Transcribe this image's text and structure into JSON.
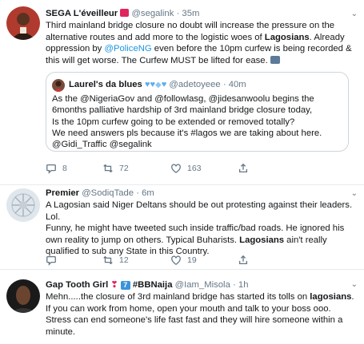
{
  "tweets": [
    {
      "name": "SEGA L'éveilleur",
      "handle": "@segalink",
      "time": "35m",
      "body": [
        "Third mainland bridge closure no doubt will increase the pressure on the",
        "alternative routes and add more to the logistic woes of ",
        "Lagosians",
        ". Already",
        "oppression by ",
        "@PoliceNG",
        " even before the 10pm curfew is being recorded &",
        "this will get worse. The Curfew MUST be lifted for ease."
      ],
      "quote": {
        "name": "Laurel's da blues",
        "handle": "@adetoyeee",
        "time": "40m",
        "lines": [
          "As the @NigeriaGov and @followlasg, @jidesanwoolu begins the",
          "6months palliative hardship of 3rd mainland bridge closure today,",
          "Is the 10pm curfew going to be extended or removed totally?",
          "We need answers pls because it's #lagos we are taking about here.",
          "@Gidi_Traffic @segalink"
        ]
      },
      "replies": "8",
      "retweets": "72",
      "likes": "163"
    },
    {
      "name": "Premier",
      "handle": "@SodiqTade",
      "time": "6m",
      "lines": [
        "A Lagosian said Niger Deltans should be out protesting against their leaders.",
        "Lol.",
        "Funny, he might have tweeted such inside traffic/bad roads. He ignored his",
        "own reality to jump on others. Typical Buharists. ",
        "Lagosians",
        " ain't really",
        "qualified to sub any State in this Country."
      ],
      "replies": "",
      "retweets": "12",
      "likes": "19"
    },
    {
      "name": "Gap Tooth Girl",
      "badge": "7",
      "tag": "#BBNaija",
      "handle": "@Iam_Misola",
      "time": "1h",
      "lines": [
        "Mehn.....the closure of 3rd mainland bridge has started its tolls on ",
        "lagosians",
        ".",
        "If you can work from home, open your mouth and talk to your boss ooo.",
        "Stress can end someone's life fast fast and they will hire someone within a",
        "minute."
      ]
    }
  ],
  "separator": "·",
  "colors": {
    "link": "#1b95e0",
    "muted": "#657786",
    "border": "#e6ecf0"
  }
}
